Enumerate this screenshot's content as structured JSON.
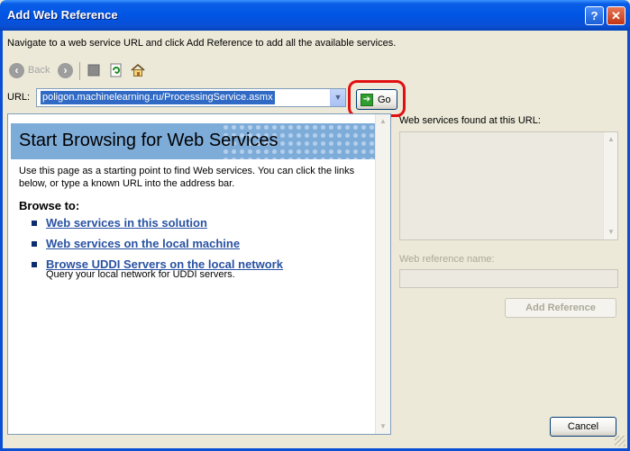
{
  "window": {
    "title": "Add Web Reference",
    "help_glyph": "?",
    "close_glyph": "✕"
  },
  "instructions": "Navigate to a web service URL and click Add Reference to add all the available services.",
  "toolbar": {
    "back_label": "Back"
  },
  "url": {
    "label": "URL:",
    "value": "poligon.machinelearning.ru/ProcessingService.asmx",
    "go_label": "Go"
  },
  "browser": {
    "heading": "Start Browsing for Web Services",
    "intro": "Use this page as a starting point to find Web services. You can click the links below, or type a known URL into the address bar.",
    "browse_to": "Browse to:",
    "links": [
      {
        "label": "Web services in this solution"
      },
      {
        "label": "Web services on the local machine"
      },
      {
        "label": "Browse UDDI Servers on the local network",
        "desc": "Query your local network for UDDI servers."
      }
    ]
  },
  "right_panel": {
    "found_label": "Web services found at this URL:",
    "ref_name_label": "Web reference name:",
    "add_reference_label": "Add Reference"
  },
  "footer": {
    "cancel_label": "Cancel"
  },
  "colors": {
    "title_bar": "#0055e5",
    "highlight": "#e01010",
    "link": "#2952a3",
    "banner": "#7eacd9"
  }
}
